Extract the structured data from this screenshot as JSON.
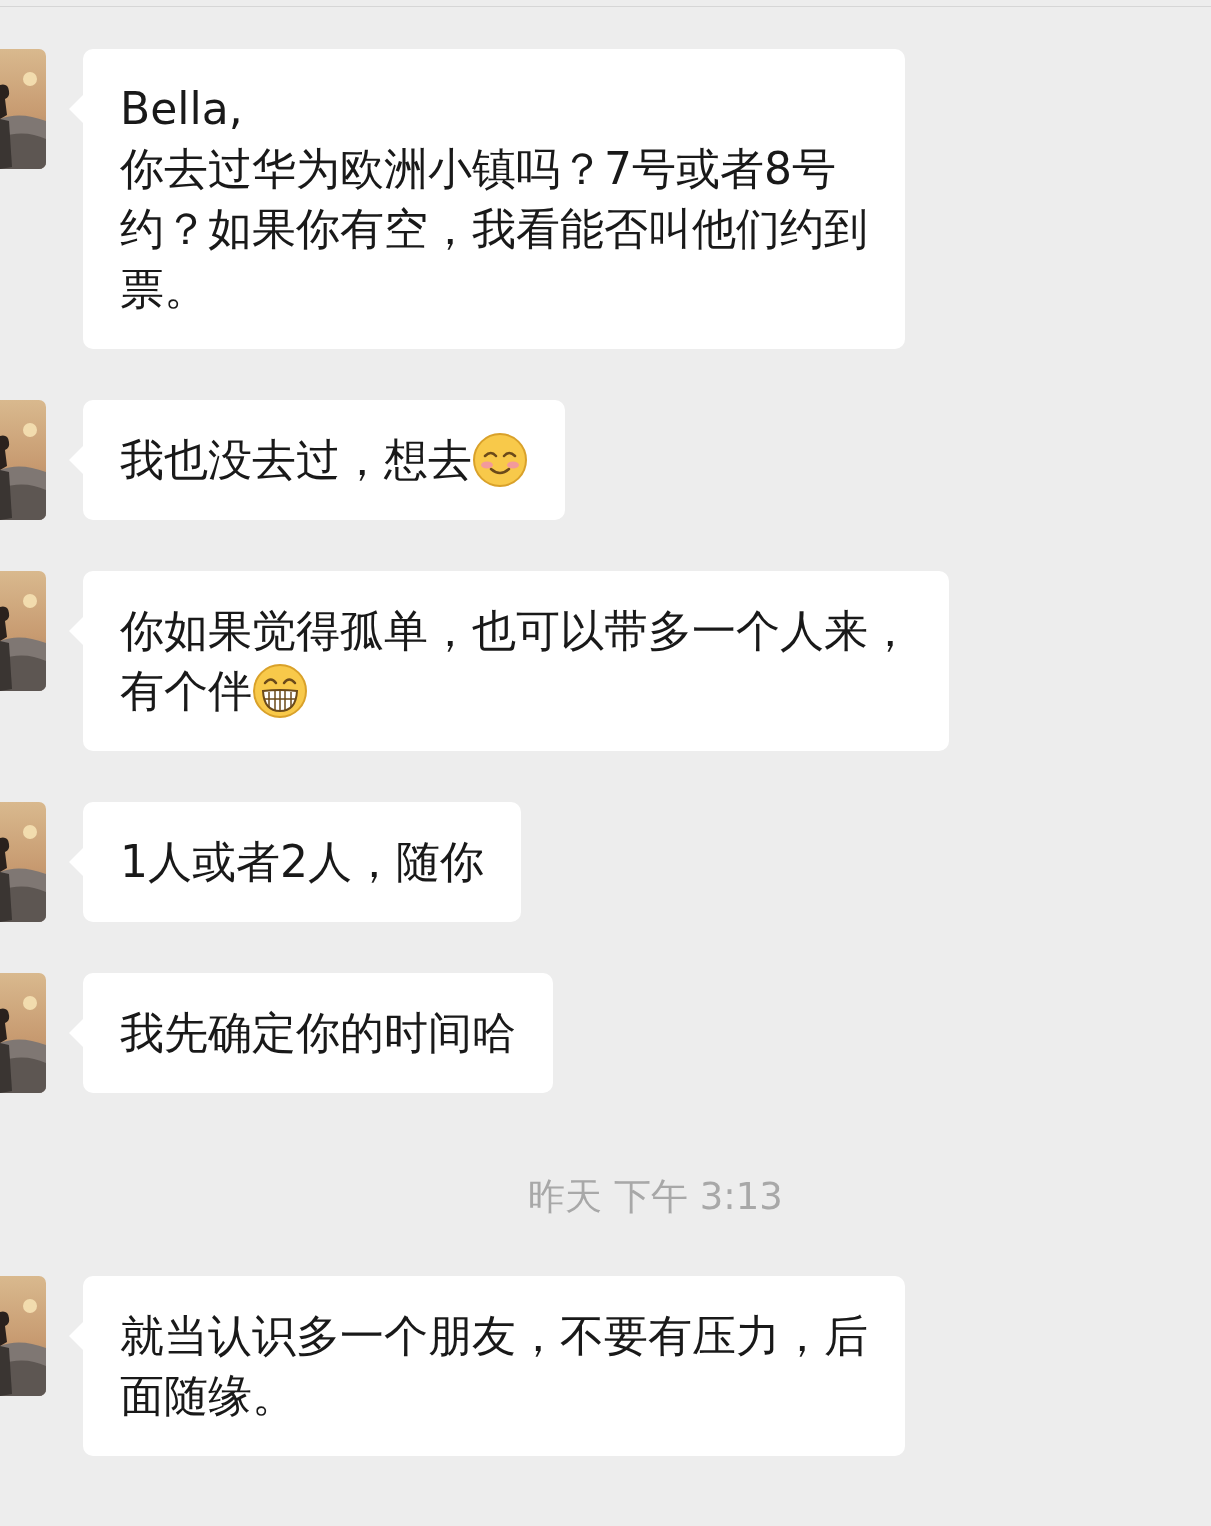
{
  "messages": [
    {
      "kind": "text",
      "lines": [
        "Bella,",
        "你去过华为欧洲小镇吗？7号或者8号",
        "约？如果你有空，我看能否叫他们约到",
        "票。"
      ]
    },
    {
      "kind": "text",
      "lines": [
        "我也没去过，想去"
      ],
      "trailing": {
        "kind": "smile"
      }
    },
    {
      "kind": "text",
      "lines": [
        "你如果觉得孤单，也可以带多一个人来，",
        "有个伴"
      ],
      "trailing": {
        "kind": "grin"
      }
    },
    {
      "kind": "text",
      "lines": [
        "1人或者2人，随你"
      ]
    },
    {
      "kind": "text",
      "lines": [
        "我先确定你的时间哈"
      ]
    },
    {
      "kind": "time",
      "text": "昨天 下午 3:13"
    },
    {
      "kind": "text",
      "lines": [
        "就当认识多一个朋友，不要有压力，后",
        "面随缘。"
      ]
    }
  ]
}
